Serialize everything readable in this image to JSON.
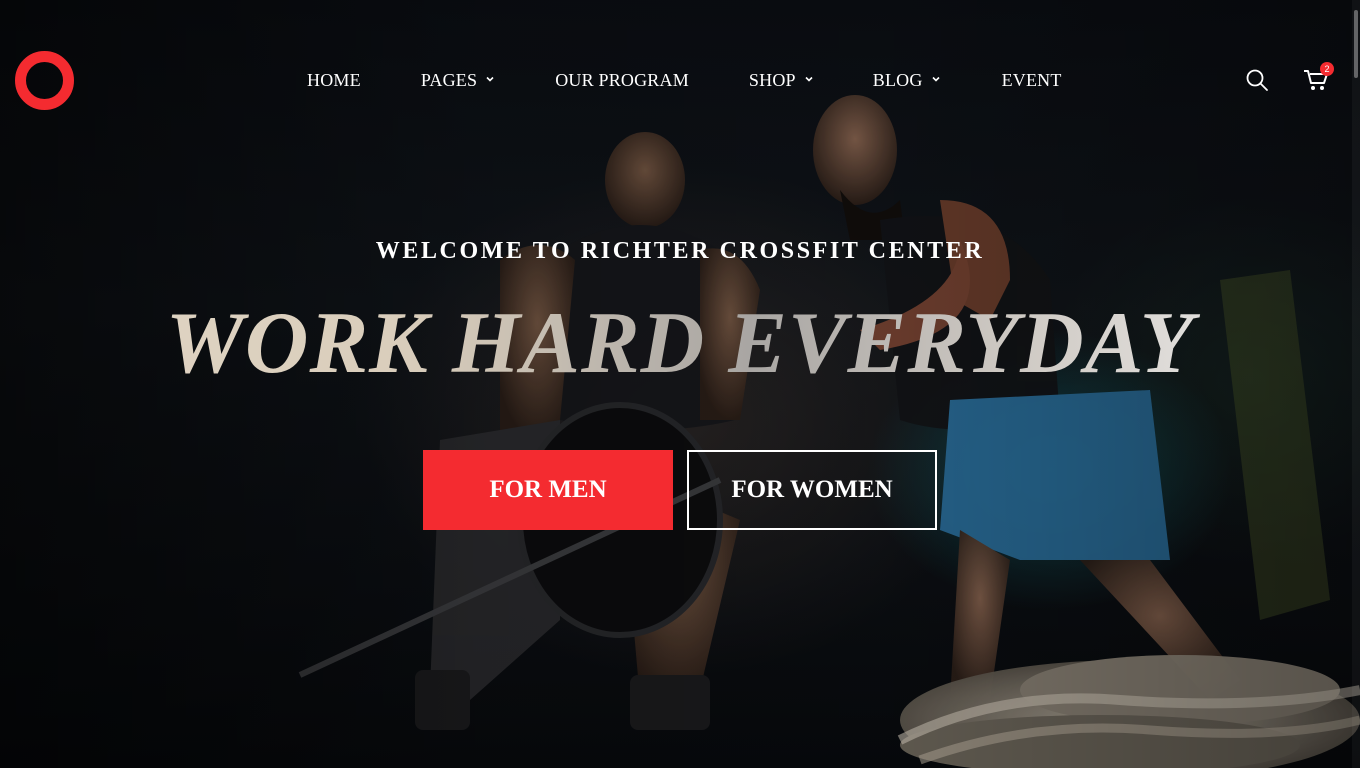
{
  "brand": {
    "logo": "logo-ring",
    "accent_color": "#f42b30"
  },
  "nav": {
    "items": [
      {
        "label": "HOME",
        "has_dropdown": false
      },
      {
        "label": "PAGES",
        "has_dropdown": true
      },
      {
        "label": "OUR PROGRAM",
        "has_dropdown": false
      },
      {
        "label": "SHOP",
        "has_dropdown": true
      },
      {
        "label": "BLOG",
        "has_dropdown": true
      },
      {
        "label": "EVENT",
        "has_dropdown": false
      }
    ]
  },
  "header_actions": {
    "search_icon": "search-icon",
    "cart_icon": "cart-icon",
    "cart_count": "2"
  },
  "hero": {
    "subtitle": "WELCOME TO RICHTER CROSSFIT CENTER",
    "headline": "WORK HARD EVERYDAY",
    "primary_button": "FOR MEN",
    "secondary_button": "FOR WOMEN"
  }
}
